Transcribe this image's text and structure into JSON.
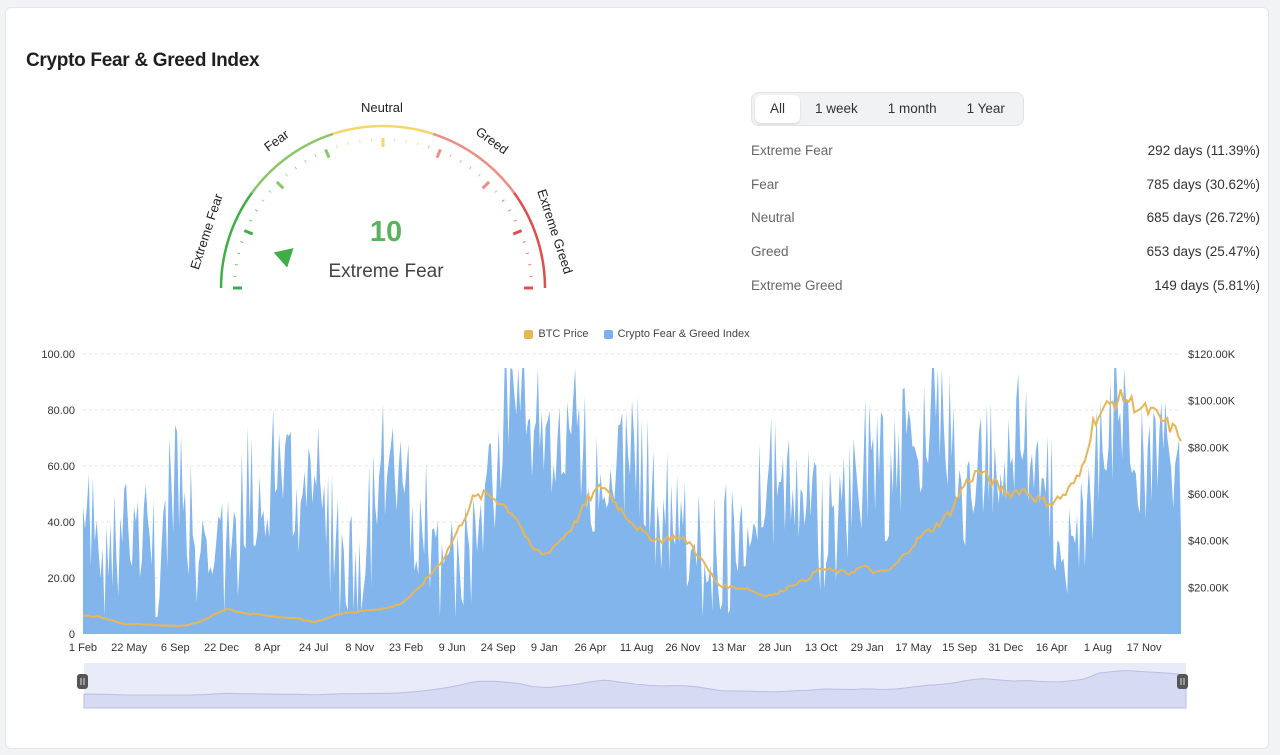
{
  "page": {
    "title": "Crypto Fear & Greed Index"
  },
  "gauge": {
    "value": "10",
    "label": "Extreme Fear",
    "segments": [
      "Extreme Fear",
      "Fear",
      "Neutral",
      "Greed",
      "Extreme Greed"
    ],
    "colors": {
      "extreme_fear": "#3fae49",
      "fear": "#8cc56a",
      "neutral": "#f3d76a",
      "greed": "#ee8e86",
      "extreme_greed": "#e14c4c",
      "value_text": "#58b35c"
    }
  },
  "filters": {
    "tabs": [
      "All",
      "1 week",
      "1 month",
      "1 Year"
    ],
    "active": "All"
  },
  "stats": [
    {
      "name": "Extreme Fear",
      "value": "292 days (11.39%)"
    },
    {
      "name": "Fear",
      "value": "785 days (30.62%)"
    },
    {
      "name": "Neutral",
      "value": "685 days (26.72%)"
    },
    {
      "name": "Greed",
      "value": "653 days (25.47%)"
    },
    {
      "name": "Extreme Greed",
      "value": "149 days (5.81%)"
    }
  ],
  "chart_data": {
    "type": "area",
    "legend": [
      {
        "name": "BTC Price",
        "color": "#e8b655"
      },
      {
        "name": "Crypto Fear & Greed Index",
        "color": "#7cb1ec"
      }
    ],
    "legend_position": "top-center",
    "x_ticks": [
      "1 Feb",
      "22 May",
      "6 Sep",
      "22 Dec",
      "8 Apr",
      "24 Jul",
      "8 Nov",
      "23 Feb",
      "9 Jun",
      "24 Sep",
      "9 Jan",
      "26 Apr",
      "11 Aug",
      "26 Nov",
      "13 Mar",
      "28 Jun",
      "13 Oct",
      "29 Jan",
      "17 May",
      "15 Sep",
      "31 Dec",
      "16 Apr",
      "1 Aug",
      "17 Nov"
    ],
    "y_left_ticks": [
      "0",
      "20.00",
      "40.00",
      "60.00",
      "80.00",
      "100.00"
    ],
    "y_left_range": [
      0,
      100
    ],
    "y_right_ticks": [
      "$20.00K",
      "$40.00K",
      "$60.00K",
      "$80.00K",
      "$100.00K",
      "$120.00K"
    ],
    "y_right_range": [
      0,
      120000
    ],
    "grid": "horizontal-dashed",
    "series": [
      {
        "name": "Crypto Fear & Greed Index",
        "axis": "left",
        "style": "area",
        "color": "#7cb1ec",
        "values": [
          30,
          35,
          25,
          20,
          40,
          30,
          25,
          45,
          50,
          30,
          25,
          20,
          25,
          45,
          55,
          50,
          60,
          40,
          45,
          55,
          30,
          25,
          20,
          35,
          55,
          60,
          50,
          40,
          30,
          20,
          15,
          25,
          35,
          55,
          80,
          85,
          75,
          60,
          70,
          80,
          70,
          50,
          40,
          60,
          70,
          55,
          45,
          40,
          30,
          25,
          20,
          25,
          30,
          40,
          45,
          50,
          55,
          50,
          40,
          30,
          35,
          45,
          55,
          60,
          55,
          50,
          65,
          70,
          75,
          80,
          60,
          45,
          55,
          60,
          65,
          70,
          60,
          50,
          40,
          30,
          40,
          55,
          70,
          80,
          75,
          60,
          55,
          60,
          50
        ]
      },
      {
        "name": "BTC Price",
        "axis": "right",
        "style": "line",
        "color": "#e8b655",
        "values": [
          8000,
          7500,
          6000,
          4000,
          4200,
          3800,
          3500,
          3600,
          5000,
          8000,
          11000,
          9000,
          8500,
          7500,
          7200,
          6500,
          5000,
          7000,
          9200,
          9500,
          10500,
          11000,
          13000,
          18000,
          25000,
          33000,
          45000,
          58000,
          60000,
          56000,
          50000,
          37000,
          34000,
          40000,
          47000,
          58000,
          64000,
          55000,
          48000,
          42000,
          40000,
          42000,
          39000,
          30000,
          21000,
          20000,
          19500,
          16500,
          17000,
          21000,
          23000,
          28000,
          27000,
          26000,
          29000,
          26000,
          28000,
          35000,
          42000,
          46000,
          52000,
          64000,
          70000,
          65000,
          60000,
          62000,
          58000,
          56000,
          60000,
          68000,
          92000,
          98000,
          102000,
          97000,
          95000,
          90000,
          85000
        ]
      }
    ],
    "navigator": true
  }
}
